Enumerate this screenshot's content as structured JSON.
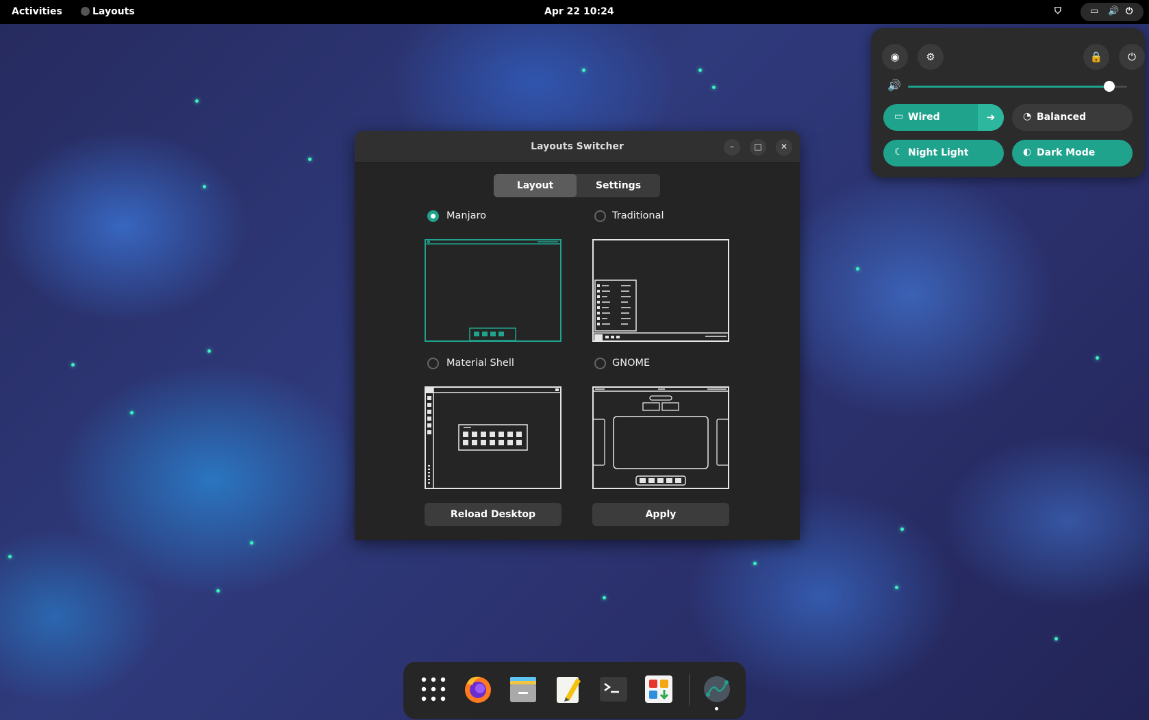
{
  "topbar": {
    "activities": "Activities",
    "app_name": "Layouts",
    "clock": "Apr 22  10:24",
    "status_icons": [
      "shield-icon",
      "network-wired-icon",
      "volume-icon",
      "power-icon"
    ]
  },
  "quick_settings": {
    "top_icons": [
      "camera-icon",
      "gear-icon",
      "lock-icon",
      "power-icon"
    ],
    "volume": {
      "level": 0.92
    },
    "toggles": [
      {
        "label": "Wired",
        "icon": "network-wired-icon",
        "on": true,
        "has_arrow": true
      },
      {
        "label": "Balanced",
        "icon": "power-profile-icon",
        "on": false
      },
      {
        "label": "Night Light",
        "icon": "moon-icon",
        "on": true
      },
      {
        "label": "Dark Mode",
        "icon": "contrast-icon",
        "on": true
      }
    ]
  },
  "window": {
    "title": "Layouts Switcher",
    "tabs": [
      {
        "label": "Layout",
        "active": true
      },
      {
        "label": "Settings",
        "active": false
      }
    ],
    "layouts": [
      {
        "label": "Manjaro",
        "selected": true
      },
      {
        "label": "Traditional",
        "selected": false
      },
      {
        "label": "Material Shell",
        "selected": false
      },
      {
        "label": "GNOME",
        "selected": false
      }
    ],
    "buttons": {
      "reload": "Reload Desktop",
      "apply": "Apply"
    }
  },
  "dock": {
    "apps": [
      "app-grid-icon",
      "firefox-icon",
      "file-manager-icon",
      "text-editor-icon",
      "terminal-icon",
      "software-center-icon",
      "layouts-app-icon"
    ]
  },
  "colors": {
    "accent": "#1fa38c",
    "panel": "#000000",
    "window_bg": "#242424"
  }
}
